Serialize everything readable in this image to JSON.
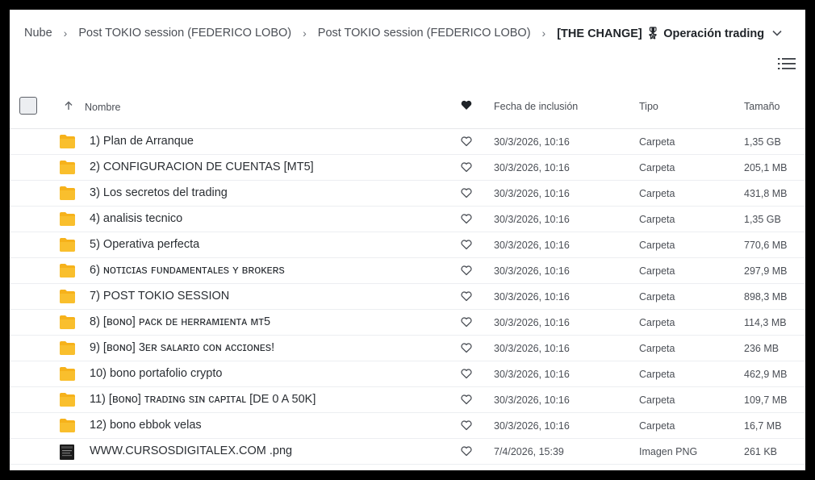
{
  "breadcrumb": {
    "items": [
      "Nube",
      "Post TOKIO session (FEDERICO LOBO)",
      "Post TOKIO session (FEDERICO LOBO)"
    ],
    "current": "[THE CHANGE] 🎖 Operación trading"
  },
  "columns": {
    "name": "Nombre",
    "date": "Fecha de inclusión",
    "type": "Tipo",
    "size": "Tamaño"
  },
  "colors": {
    "folder": "#f6b21b",
    "favorite_header": "#1f2328",
    "border": "#e6e7ea"
  },
  "rows": [
    {
      "name": "1) Plan de Arranque",
      "date": "30/3/2026, 10:16",
      "type": "Carpeta",
      "size": "1,35 GB",
      "icon": "folder-icon"
    },
    {
      "name": "2) CONFIGURACION DE CUENTAS [MT5]",
      "date": "30/3/2026, 10:16",
      "type": "Carpeta",
      "size": "205,1 MB",
      "icon": "folder-icon"
    },
    {
      "name": "3) Los secretos del trading",
      "date": "30/3/2026, 10:16",
      "type": "Carpeta",
      "size": "431,8 MB",
      "icon": "folder-icon"
    },
    {
      "name": "4) analisis tecnico",
      "date": "30/3/2026, 10:16",
      "type": "Carpeta",
      "size": "1,35 GB",
      "icon": "folder-icon"
    },
    {
      "name": "5) Operativa perfecta",
      "date": "30/3/2026, 10:16",
      "type": "Carpeta",
      "size": "770,6 MB",
      "icon": "folder-icon"
    },
    {
      "name": "6) ɴᴏᴛɪᴄɪᴀs ꜰᴜɴᴅᴀᴍᴇɴᴛᴀʟᴇs ʏ ʙʀᴏᴋᴇʀs",
      "date": "30/3/2026, 10:16",
      "type": "Carpeta",
      "size": "297,9 MB",
      "icon": "folder-icon"
    },
    {
      "name": "7) POST TOKIO SESSION",
      "date": "30/3/2026, 10:16",
      "type": "Carpeta",
      "size": "898,3 MB",
      "icon": "folder-icon"
    },
    {
      "name": "8) [ʙᴏɴᴏ] ᴘᴀᴄᴋ ᴅᴇ ʜᴇʀʀᴀᴍɪᴇɴᴛᴀ ᴍᴛ5",
      "date": "30/3/2026, 10:16",
      "type": "Carpeta",
      "size": "114,3 MB",
      "icon": "folder-icon"
    },
    {
      "name": "9) [ʙᴏɴᴏ] 3ᴇʀ sᴀʟᴀʀɪᴏ ᴄᴏɴ ᴀᴄᴄɪᴏɴᴇs!",
      "date": "30/3/2026, 10:16",
      "type": "Carpeta",
      "size": "236 MB",
      "icon": "folder-icon"
    },
    {
      "name": "10) bono portafolio crypto",
      "date": "30/3/2026, 10:16",
      "type": "Carpeta",
      "size": "462,9 MB",
      "icon": "folder-icon"
    },
    {
      "name": "11) [ʙᴏɴᴏ] ᴛʀᴀᴅɪɴɢ sɪɴ ᴄᴀᴘɪᴛᴀʟ [DE 0 A 50K]",
      "date": "30/3/2026, 10:16",
      "type": "Carpeta",
      "size": "109,7 MB",
      "icon": "folder-icon"
    },
    {
      "name": "12) bono ebbok velas",
      "date": "30/3/2026, 10:16",
      "type": "Carpeta",
      "size": "16,7 MB",
      "icon": "folder-icon"
    },
    {
      "name": "WWW.CURSOSDIGITALEX.COM .png",
      "date": "7/4/2026, 15:39",
      "type": "Imagen PNG",
      "size": "261 KB",
      "icon": "image-file-icon"
    }
  ]
}
